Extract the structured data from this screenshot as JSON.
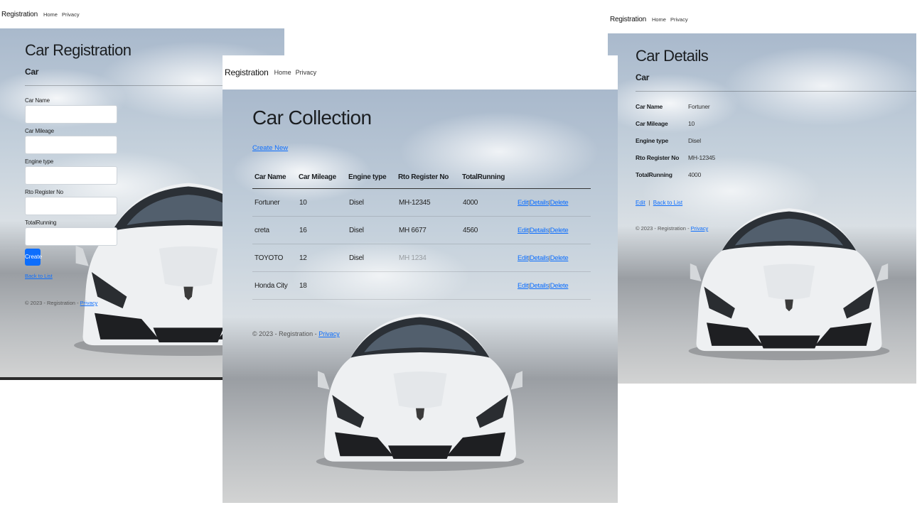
{
  "nav": {
    "brand": "Registration",
    "home": "Home",
    "privacy": "Privacy"
  },
  "registration_page": {
    "title": "Car Registration",
    "subtitle": "Car",
    "fields": [
      {
        "label": "Car Name",
        "value": ""
      },
      {
        "label": "Car Mileage",
        "value": ""
      },
      {
        "label": "Engine type",
        "value": ""
      },
      {
        "label": "Rto Register No",
        "value": ""
      },
      {
        "label": "TotalRunning",
        "value": ""
      }
    ],
    "create_label": "Create",
    "back_label": "Back to List",
    "footer_text": "© 2023 - Registration - ",
    "footer_link": "Privacy"
  },
  "collection_page": {
    "title": "Car Collection",
    "create_new_label": "Create New",
    "headers": [
      "Car Name",
      "Car Mileage",
      "Engine type",
      "Rto Register No",
      "TotalRunning"
    ],
    "rows": [
      {
        "name": "Fortuner",
        "mileage": "10",
        "engine": "Disel",
        "rto": "MH-12345",
        "running": "4000"
      },
      {
        "name": "creta",
        "mileage": "16",
        "engine": "Disel",
        "rto": "MH 6677",
        "running": "4560"
      },
      {
        "name": "TOYOTO",
        "mileage": "12",
        "engine": "Disel",
        "rto": "MH 1234",
        "running": ""
      },
      {
        "name": "Honda City",
        "mileage": "18",
        "engine": "",
        "rto": "",
        "running": ""
      }
    ],
    "actions": {
      "edit": "Edit",
      "details": "Details",
      "delete": "Delete",
      "sep": "|"
    },
    "footer_text": "© 2023 - Registration - ",
    "footer_link": "Privacy"
  },
  "details_page": {
    "title": "Car Details",
    "subtitle": "Car",
    "items": [
      {
        "label": "Car Name",
        "value": "Fortuner"
      },
      {
        "label": "Car Mileage",
        "value": "10"
      },
      {
        "label": "Engine type",
        "value": "Disel"
      },
      {
        "label": "Rto Register No",
        "value": "MH-12345"
      },
      {
        "label": "TotalRunning",
        "value": "4000"
      }
    ],
    "edit_label": "Edit",
    "sep": "|",
    "back_label": "Back to List",
    "footer_text": "© 2023 - Registration - ",
    "footer_link": "Privacy"
  },
  "colors": {
    "link": "#0d6efd",
    "button": "#0d6efd",
    "car_body": "#f2f3f4",
    "grille": "#1e1f22"
  }
}
